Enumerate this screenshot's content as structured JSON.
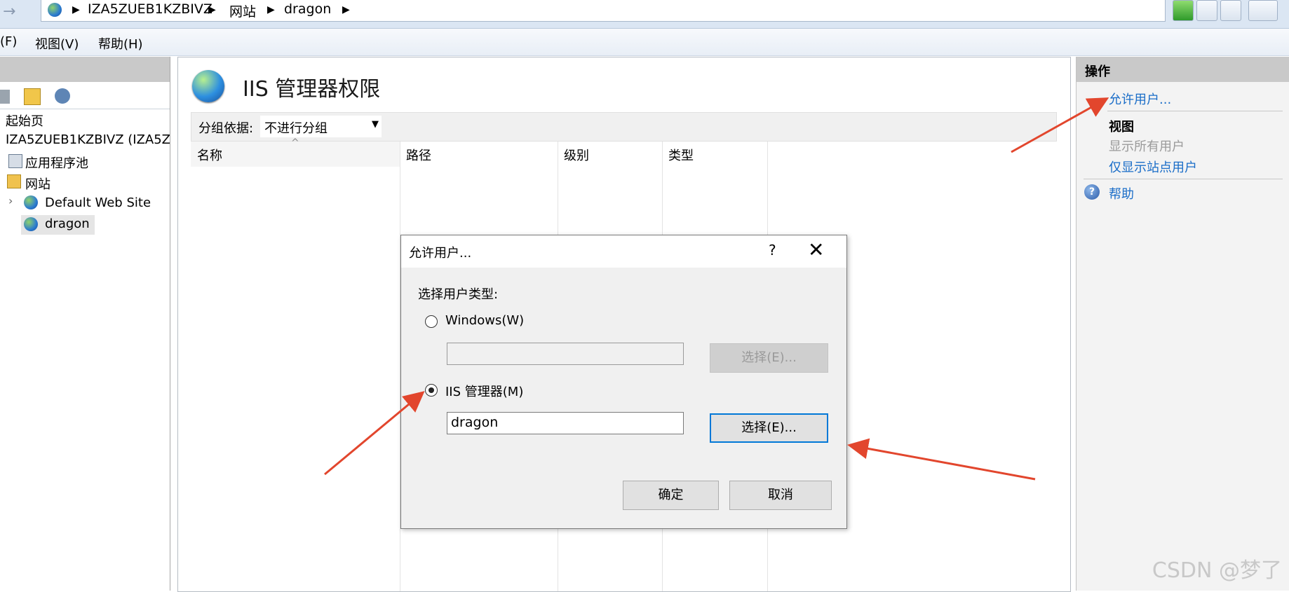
{
  "address_bar": {
    "crumbs": [
      "IZA5ZUEB1KZBIVZ",
      "网站",
      "dragon"
    ]
  },
  "menu": {
    "items": [
      "(F)",
      "视图(V)",
      "帮助(H)"
    ]
  },
  "tree": {
    "start_page": "起始页",
    "server": "IZA5ZUEB1KZBIVZ (IZA5ZU",
    "app_pools": "应用程序池",
    "sites": "网站",
    "default_site": "Default Web Site",
    "selected_site": "dragon"
  },
  "main": {
    "title": "IIS 管理器权限",
    "group_by_label": "分组依据:",
    "group_by_value": "不进行分组",
    "columns": [
      "名称",
      "路径",
      "级别",
      "类型"
    ]
  },
  "actions": {
    "header": "操作",
    "allow_user": "允许用户...",
    "view_heading": "视图",
    "show_all_users": "显示所有用户",
    "show_site_users": "仅显示站点用户",
    "help": "帮助"
  },
  "dialog": {
    "title": "允许用户...",
    "help_glyph": "?",
    "prompt": "选择用户类型:",
    "windows_option": "Windows(W)",
    "windows_value": "",
    "windows_select_button": "选择(E)...",
    "iis_option": "IIS 管理器(M)",
    "iis_value": "dragon",
    "iis_select_button": "选择(E)...",
    "ok_button": "确定",
    "cancel_button": "取消",
    "selected_option": "iis"
  },
  "watermark": "CSDN @梦了",
  "colors": {
    "annotation_arrow": "#e2462d",
    "link": "#1a6dc8",
    "focus": "#0078d7"
  }
}
